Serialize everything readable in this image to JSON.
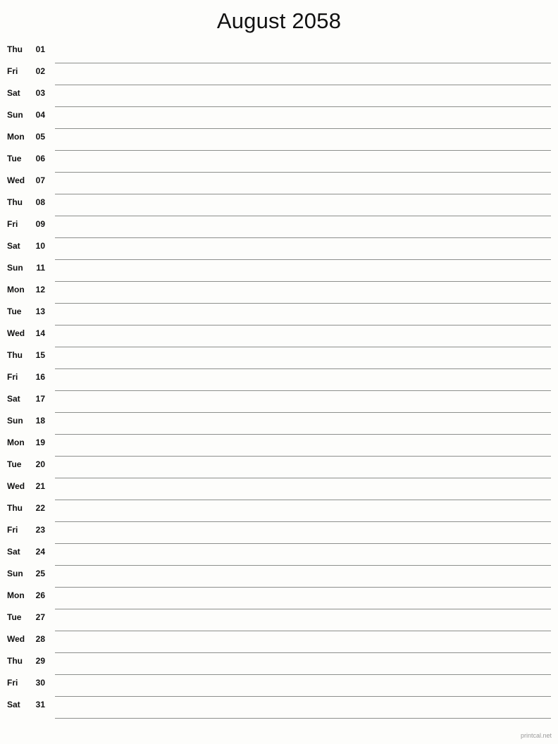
{
  "header": {
    "title": "August 2058"
  },
  "calendar": {
    "month": "August",
    "year": "2058",
    "rows": [
      {
        "dow": "Thu",
        "day": "01"
      },
      {
        "dow": "Fri",
        "day": "02"
      },
      {
        "dow": "Sat",
        "day": "03"
      },
      {
        "dow": "Sun",
        "day": "04"
      },
      {
        "dow": "Mon",
        "day": "05"
      },
      {
        "dow": "Tue",
        "day": "06"
      },
      {
        "dow": "Wed",
        "day": "07"
      },
      {
        "dow": "Thu",
        "day": "08"
      },
      {
        "dow": "Fri",
        "day": "09"
      },
      {
        "dow": "Sat",
        "day": "10"
      },
      {
        "dow": "Sun",
        "day": "11"
      },
      {
        "dow": "Mon",
        "day": "12"
      },
      {
        "dow": "Tue",
        "day": "13"
      },
      {
        "dow": "Wed",
        "day": "14"
      },
      {
        "dow": "Thu",
        "day": "15"
      },
      {
        "dow": "Fri",
        "day": "16"
      },
      {
        "dow": "Sat",
        "day": "17"
      },
      {
        "dow": "Sun",
        "day": "18"
      },
      {
        "dow": "Mon",
        "day": "19"
      },
      {
        "dow": "Tue",
        "day": "20"
      },
      {
        "dow": "Wed",
        "day": "21"
      },
      {
        "dow": "Thu",
        "day": "22"
      },
      {
        "dow": "Fri",
        "day": "23"
      },
      {
        "dow": "Sat",
        "day": "24"
      },
      {
        "dow": "Sun",
        "day": "25"
      },
      {
        "dow": "Mon",
        "day": "26"
      },
      {
        "dow": "Tue",
        "day": "27"
      },
      {
        "dow": "Wed",
        "day": "28"
      },
      {
        "dow": "Thu",
        "day": "29"
      },
      {
        "dow": "Fri",
        "day": "30"
      },
      {
        "dow": "Sat",
        "day": "31"
      }
    ]
  },
  "footer": {
    "attribution": "printcal.net"
  },
  "colors": {
    "background": "#fdfdfb",
    "rule": "#8d8f8c",
    "text": "#111111",
    "footer_text": "#9a9a9a"
  }
}
